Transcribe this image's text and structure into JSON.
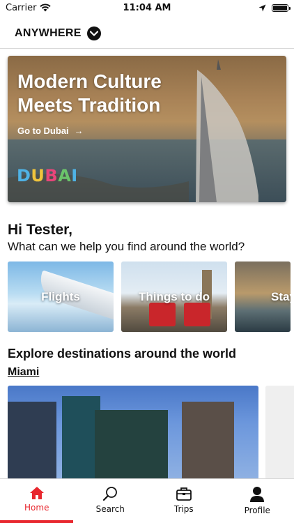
{
  "status_bar": {
    "carrier": "Carrier",
    "time": "11:04 AM"
  },
  "header": {
    "location": "ANYWHERE"
  },
  "hero": {
    "title": "Modern Culture Meets Tradition",
    "link": "Go to Dubai",
    "logo_letters": [
      "D",
      "U",
      "B",
      "A",
      "I"
    ]
  },
  "greeting": {
    "title": "Hi Tester,",
    "subtitle": "What can we help you find around the world?"
  },
  "categories": [
    {
      "label": "Flights"
    },
    {
      "label": "Things to do"
    },
    {
      "label": "Stay"
    }
  ],
  "explore": {
    "title": "Explore destinations around the world",
    "city": "Miami"
  },
  "tabs": [
    {
      "label": "Home",
      "active": true
    },
    {
      "label": "Search",
      "active": false
    },
    {
      "label": "Trips",
      "active": false
    },
    {
      "label": "Profile",
      "active": false
    }
  ],
  "colors": {
    "accent": "#e8272e",
    "text": "#111111"
  }
}
